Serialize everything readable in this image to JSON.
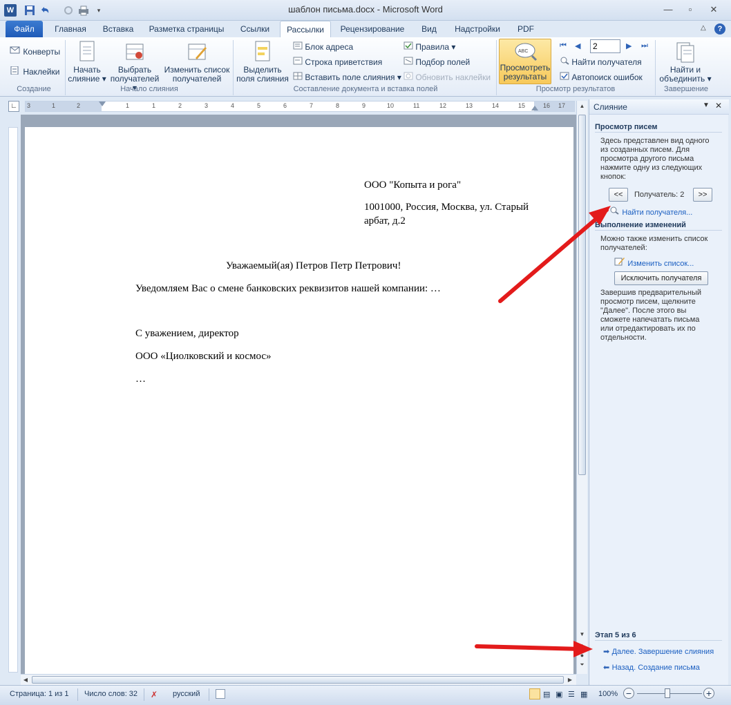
{
  "window": {
    "title": "шаблон письма.docx  -  Microsoft Word"
  },
  "tabs": [
    "Файл",
    "Главная",
    "Вставка",
    "Разметка страницы",
    "Ссылки",
    "Рассылки",
    "Рецензирование",
    "Вид",
    "Надстройки",
    "PDF"
  ],
  "ribbon": {
    "create": {
      "envelopes": "Конверты",
      "labels": "Наклейки",
      "group": "Создание"
    },
    "start": {
      "start_merge_1": "Начать",
      "start_merge_2": "слияние",
      "select_rec_1": "Выбрать",
      "select_rec_2": "получателей",
      "edit_list_1": "Изменить список",
      "edit_list_2": "получателей",
      "group": "Начало слияния"
    },
    "compose": {
      "highlight_1": "Выделить",
      "highlight_2": "поля слияния",
      "address_block": "Блок адреса",
      "greeting_line": "Строка приветствия",
      "insert_field": "Вставить поле слияния",
      "rules": "Правила",
      "match_fields": "Подбор полей",
      "update_labels": "Обновить наклейки",
      "group": "Составление документа и вставка полей"
    },
    "preview": {
      "preview_1": "Просмотреть",
      "preview_2": "результаты",
      "record": "2",
      "find_recipient": "Найти получателя",
      "auto_check": "Автопоиск ошибок",
      "group": "Просмотр результатов"
    },
    "finish": {
      "finish_1": "Найти и",
      "finish_2": "объединить",
      "group": "Завершение"
    }
  },
  "ruler": [
    "3",
    "1",
    "2",
    "1",
    "1",
    "2",
    "3",
    "4",
    "5",
    "6",
    "7",
    "8",
    "9",
    "10",
    "11",
    "12",
    "13",
    "14",
    "15",
    "16",
    "17"
  ],
  "document": {
    "company": "ООО \"Копыта и рога\"",
    "address_1": "1001000, Россия, Москва, ул. Старый",
    "address_2": "арбат, д.2",
    "greeting": "Уважаемый(ая)  Петров Петр Петрович!",
    "body": "Уведомляем Вас о смене банковских реквизитов нашей компании: …",
    "closing": "С уважением, директор",
    "signature": "ООО «Циолковский и космос»",
    "ellipsis": "…"
  },
  "pane": {
    "title": "Слияние",
    "preview_heading": "Просмотр писем",
    "preview_text": [
      "Здесь представлен вид одного",
      "из созданных писем. Для",
      "просмотра другого письма",
      "нажмите одну из следующих",
      "кнопок:"
    ],
    "prev_btn": "<<",
    "next_btn": ">>",
    "recipient": "Получатель: 2",
    "find_link": "Найти получателя...",
    "changes_heading": "Выполнение изменений",
    "changes_text": [
      "Можно также изменить список",
      "получателей:"
    ],
    "edit_list_link": "Изменить список...",
    "exclude_btn": "Исключить получателя",
    "finish_text": [
      "Завершив предварительный",
      "просмотр писем, щелкните",
      "\"Далее\". После этого вы",
      "сможете напечатать письма",
      "или отредактировать их по",
      "отдельности."
    ],
    "step": "Этап 5 из 6",
    "next_link": "Далее. Завершение слияния",
    "back_link": "Назад. Создание письма"
  },
  "status": {
    "page": "Страница: 1 из 1",
    "words": "Число слов: 32",
    "language": "русский",
    "zoom": "100%"
  },
  "colors": {
    "accent": "#1f5bb8",
    "arrow": "#e31b1b",
    "link": "#1b5fc1"
  }
}
